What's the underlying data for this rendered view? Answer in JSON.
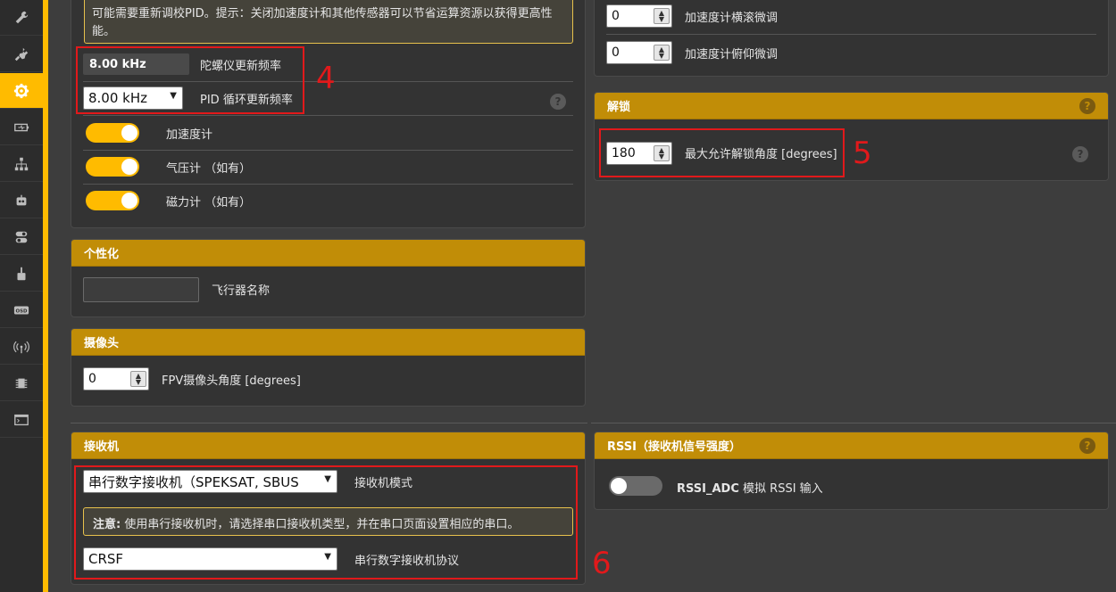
{
  "sidebar": {
    "items": [
      {
        "icon": "wrench-icon"
      },
      {
        "icon": "plug-icon"
      },
      {
        "icon": "gear-icon",
        "active": true
      },
      {
        "icon": "battery-icon"
      },
      {
        "icon": "hierarchy-icon"
      },
      {
        "icon": "robot-icon"
      },
      {
        "icon": "toggles-icon"
      },
      {
        "icon": "motor-icon"
      },
      {
        "icon": "osd-icon",
        "text": "OSD"
      },
      {
        "icon": "antenna-icon"
      },
      {
        "icon": "chip-icon"
      },
      {
        "icon": "terminal-icon"
      }
    ]
  },
  "system": {
    "warning_text": "可能需要重新调校PID。提示：关闭加速度计和其他传感器可以节省运算资源以获得更高性能。",
    "gyro_rate_value": "8.00 kHz",
    "gyro_rate_label": "陀螺仪更新频率",
    "pid_rate_value": "8.00 kHz",
    "pid_rate_label": "PID 循环更新频率",
    "accel_label": "加速度计",
    "baro_label": "气压计 （如有）",
    "mag_label": "磁力计 （如有）"
  },
  "accel_trim": {
    "roll_value": "0",
    "roll_label": "加速度计横滚微调",
    "pitch_value": "0",
    "pitch_label": "加速度计俯仰微调"
  },
  "arming": {
    "title": "解锁",
    "max_angle_value": "180",
    "max_angle_label": "最大允许解锁角度 [degrees]"
  },
  "personalization": {
    "title": "个性化",
    "craft_name_value": "",
    "craft_name_label": "飞行器名称"
  },
  "camera": {
    "title": "摄像头",
    "angle_value": "0",
    "angle_label": "FPV摄像头角度 [degrees]"
  },
  "receiver": {
    "title": "接收机",
    "mode_value": "串行数字接收机（SPEKSAT, SBUS",
    "mode_label": "接收机模式",
    "note_bold": "注意:",
    "note_text": " 使用串行接收机时，请选择串口接收机类型，并在串口页面设置相应的串口。",
    "protocol_value": "CRSF",
    "protocol_label": "串行数字接收机协议"
  },
  "rssi": {
    "title": "RSSI（接收机信号强度）",
    "adc_bold": "RSSI_ADC",
    "adc_label": " 模拟 RSSI 输入"
  },
  "help_glyph": "?",
  "annotations": {
    "a4": "4",
    "a5": "5",
    "a6": "6"
  },
  "colors": {
    "accent": "#ffbb00",
    "header": "#c18d07",
    "highlight": "#e1191b"
  }
}
